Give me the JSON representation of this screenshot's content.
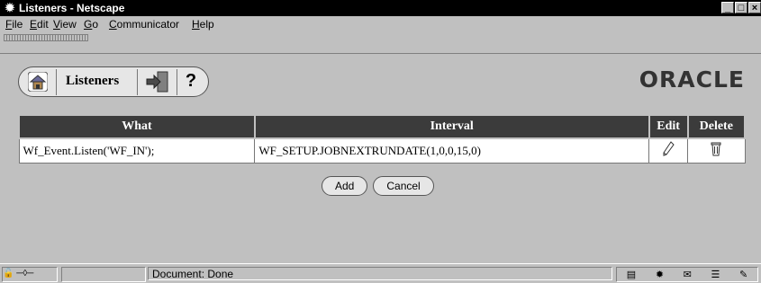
{
  "window": {
    "title": "Listeners - Netscape",
    "min": "_",
    "max": "□",
    "close": "×"
  },
  "menu": [
    {
      "label": "File",
      "ul": "F",
      "rest": "ile"
    },
    {
      "label": "Edit",
      "ul": "E",
      "rest": "dit"
    },
    {
      "label": "View",
      "ul": "V",
      "rest": "iew"
    },
    {
      "label": "Go",
      "ul": "G",
      "rest": "o"
    },
    {
      "label": "Communicator",
      "ul": "C",
      "rest": "ommunicator"
    },
    {
      "label": "Help",
      "ul": "H",
      "rest": "elp"
    }
  ],
  "nav": {
    "title": "Listeners",
    "help": "?"
  },
  "brand": "ORACLE",
  "table": {
    "headers": [
      "What",
      "Interval",
      "Edit",
      "Delete"
    ],
    "rows": [
      {
        "what": "Wf_Event.Listen('WF_IN');",
        "interval": "WF_SETUP.JOBNEXTRUNDATE(1,0,0,15,0)"
      }
    ]
  },
  "buttons": {
    "add": "Add",
    "cancel": "Cancel"
  },
  "status": {
    "text": "Document: Done"
  },
  "icons": [
    "netscape-icon",
    "home-icon",
    "exit-icon",
    "help-icon",
    "pencil-icon",
    "trash-icon",
    "lock-icon",
    "network-icon"
  ]
}
